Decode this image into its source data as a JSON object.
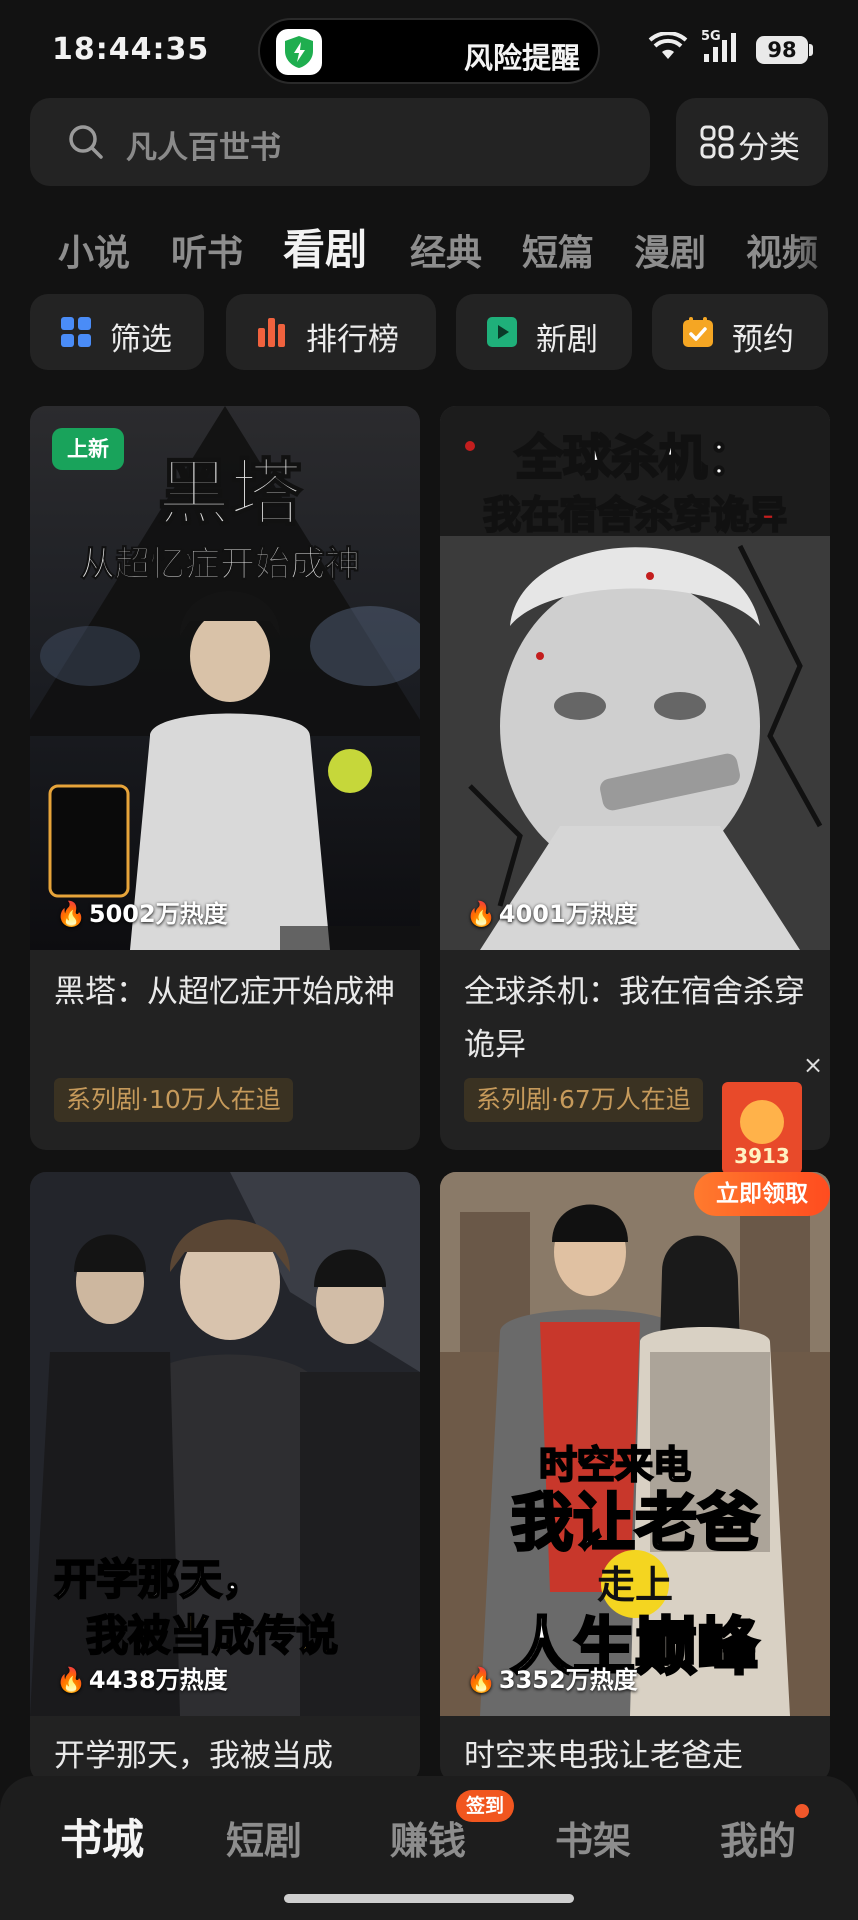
{
  "status_bar": {
    "time": "18:44:35",
    "island_text": "风险提醒",
    "network": "5G",
    "battery": "98"
  },
  "search": {
    "placeholder": "凡人百世书",
    "category_label": "分类"
  },
  "tabs": [
    "小说",
    "听书",
    "看剧",
    "经典",
    "短篇",
    "漫剧",
    "视频"
  ],
  "active_tab": "看剧",
  "quick_buttons": [
    {
      "label": "筛选",
      "icon": "grid-icon",
      "color": "#4a8cf7"
    },
    {
      "label": "排行榜",
      "icon": "bar-chart-icon",
      "color": "#f0623e"
    },
    {
      "label": "新剧",
      "icon": "play-icon",
      "color": "#1fb07a"
    },
    {
      "label": "预约",
      "icon": "calendar-check-icon",
      "color": "#f5a623"
    }
  ],
  "cards": [
    {
      "badge": "上新",
      "cover_title": "黑塔",
      "cover_subtitle": "从超忆症开始成神",
      "heat": "5002万热度",
      "title": "黑塔：从超忆症开始成神",
      "tag": "系列剧·10万人在追"
    },
    {
      "cover_title": "全球杀机：",
      "cover_subtitle": "我在宿舍杀穿诡异",
      "heat": "4001万热度",
      "title": "全球杀机：我在宿舍杀穿诡异",
      "tag": "系列剧·67万人在追"
    },
    {
      "cover_title": "开学那天，",
      "cover_subtitle": "我被当成传说",
      "heat": "4438万热度",
      "title": "开学那天，我被当成"
    },
    {
      "cover_title": "时空来电",
      "cover_subtitle": "我让老爸",
      "cover_line3": "走上",
      "cover_line4": "人生巅峰",
      "heat": "3352万热度",
      "title": "时空来电我让老爸走"
    }
  ],
  "floating_reward": {
    "amount": "3913",
    "claim_label": "立即领取",
    "close": "×"
  },
  "bottom_nav": {
    "items": [
      "书城",
      "短剧",
      "赚钱",
      "书架",
      "我的"
    ],
    "active": "书城",
    "signin_badge": "签到"
  },
  "colors": {
    "background": "#121212",
    "surface": "#222222",
    "accent_orange": "#f1561f",
    "new_badge_green": "#19a35b",
    "tag_gold": "#c69a5b"
  }
}
